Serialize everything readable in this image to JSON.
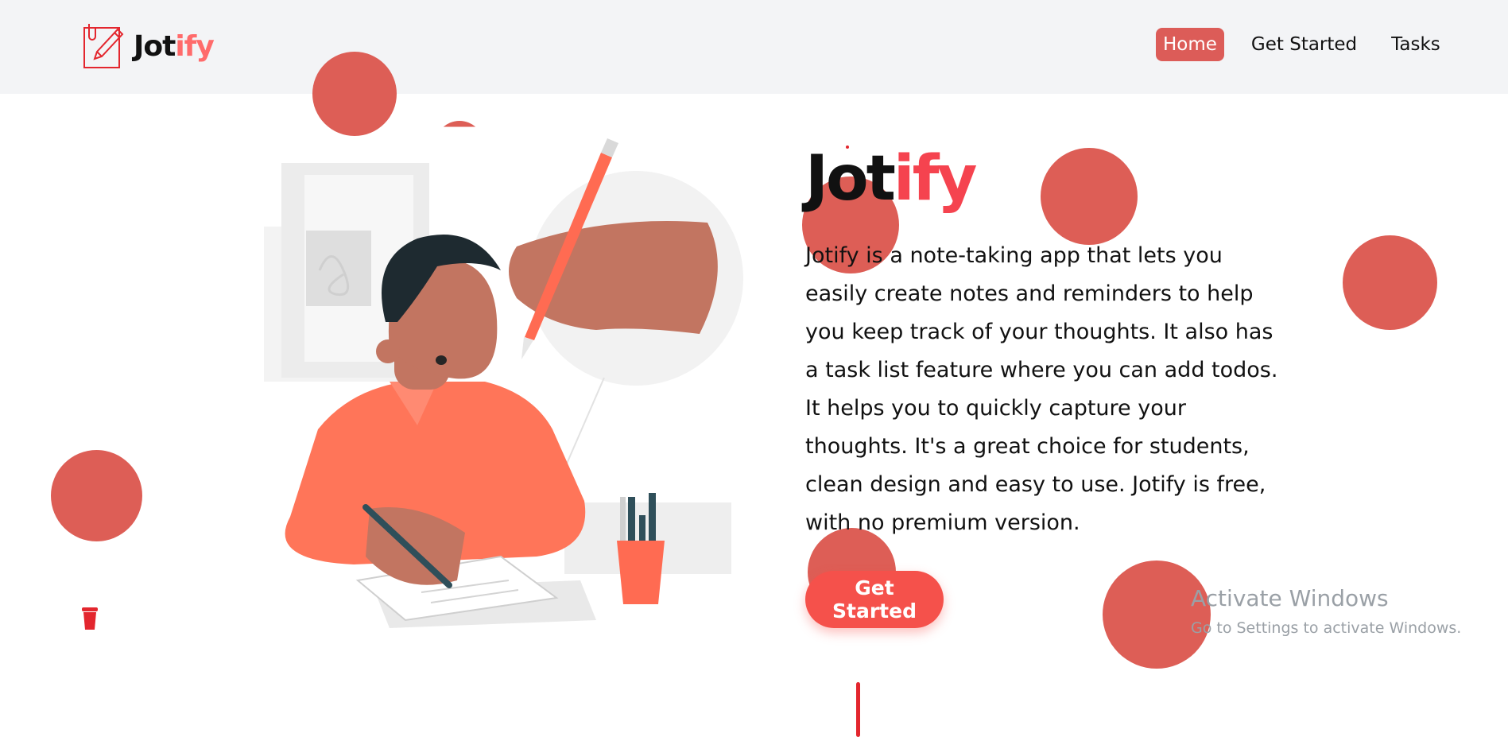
{
  "brand": {
    "name_part1": "Jot",
    "name_part2": "ify",
    "logo_icon": "notepad-pencil-icon"
  },
  "nav": {
    "items": [
      {
        "label": "Home",
        "active": true
      },
      {
        "label": "Get Started",
        "active": false
      },
      {
        "label": "Tasks",
        "active": false
      }
    ]
  },
  "hero": {
    "title_part1": "Jot",
    "title_part2": "ify",
    "description": "Jotify is a note-taking app that lets you easily create notes and reminders to help you keep track of your thoughts. It also has a task list feature where you can add todos. It helps you to quickly capture your thoughts. It's a great choice for students, clean design and easy to use. Jotify is free, with no premium version.",
    "cta_label": "Get Started",
    "illustration": "person-writing-notes-illustration"
  },
  "watermark": {
    "title": "Activate Windows",
    "subtitle": "Go to Settings to activate Windows."
  },
  "colors": {
    "accent": "#dc5c58",
    "blob": "#dd5e56",
    "title_accent": "#f5434f",
    "cta": "#f5514b",
    "nav_bg": "#f3f4f6"
  }
}
